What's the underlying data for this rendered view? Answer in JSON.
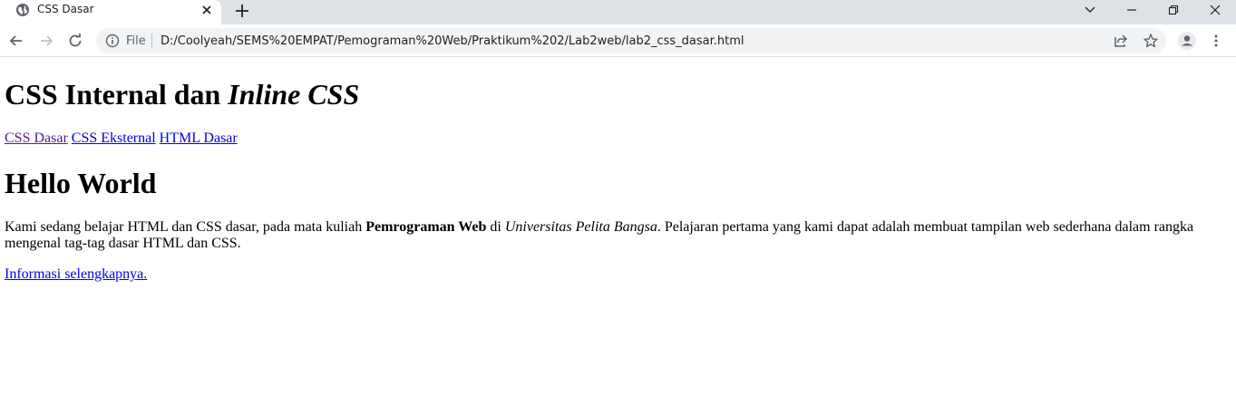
{
  "browser": {
    "tab_title": "CSS Dasar",
    "file_label": "File",
    "url": "D:/Coolyeah/SEMS%20EMPAT/Pemograman%20Web/Praktikum%202/Lab2web/lab2_css_dasar.html"
  },
  "page": {
    "title_plain": "CSS Internal dan ",
    "title_italic": "Inline CSS",
    "nav_links": [
      "CSS Dasar",
      "CSS Eksternal",
      "HTML Dasar"
    ],
    "heading": "Hello World",
    "paragraph": {
      "part1": "Kami sedang belajar HTML dan CSS dasar, pada mata kuliah ",
      "bold": "Pemrograman Web",
      "part2": " di ",
      "italic": "Universitas Pelita Bangsa",
      "part3": ". Pelajaran pertama yang kami dapat adalah membuat tampilan web sederhana dalam rangka mengenal tag-tag dasar HTML dan CSS."
    },
    "more_link": "Informasi selengkapnya."
  }
}
